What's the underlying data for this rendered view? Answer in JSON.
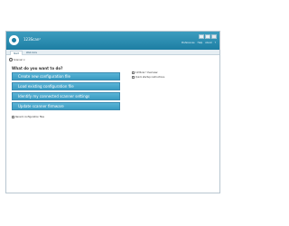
{
  "window": {
    "title": "123Scan²"
  },
  "top_links": [
    "Preferences",
    "Help",
    "About",
    "?"
  ],
  "tabs": [
    {
      "label": "Start"
    },
    {
      "label": "Web links"
    }
  ],
  "toolbar": {
    "scanner_label": "Scanner"
  },
  "main": {
    "heading": "What do you want to do?",
    "actions": [
      {
        "label": "Create new configuration file"
      },
      {
        "label": "Load existing configuration file"
      },
      {
        "label": "Identify my connected scanner settings"
      },
      {
        "label": "Update scanner firmware"
      }
    ],
    "recent_label": "Recent configuration files"
  },
  "side_links": [
    {
      "label": "123Scan² Overview"
    },
    {
      "label": "Quick startup instructions"
    }
  ],
  "colors": {
    "titlebar": "#1d7ea3",
    "button": "#3a9bc2",
    "button_text": "#ffffff"
  }
}
